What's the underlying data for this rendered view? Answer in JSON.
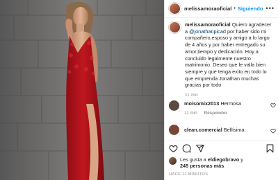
{
  "header": {
    "username": "melissamoraoficial",
    "separator": "•",
    "follow_label": "Siguiendo",
    "more_icon": "ellipsis-icon"
  },
  "caption": {
    "username": "melissamoraoficial",
    "text_before": "Quiero agradecer a ",
    "mention": "@jonathanpicad",
    "text_after": " por haber sido mi compañero,esposo y amigo a lo largo de 4 años y por haber entregado su amor,tiempo y dedicación. Hoy a concluido legalmente nuestro matrimonio. Deseo que le valla bien siempre y que tenga exito en todo lo que emprenda Jonathan muchas gracias por todo",
    "time": "11 min"
  },
  "comments": [
    {
      "username": "moisomix2013",
      "text": "Hermosa",
      "time": "11 min",
      "reply_label": "Responder",
      "avatar_color": "#5b4a42"
    },
    {
      "username": "clean.comercial",
      "text": "Bellísima",
      "avatar_color": "#7a4638"
    }
  ],
  "likes": {
    "prefix": "Les gusta a ",
    "liker": "eldiegobravo",
    "middle": " y",
    "count_text": "245 personas más"
  },
  "timestamp": "HACE 11 MINUTOS",
  "colors": {
    "accent": "#0095f6",
    "mention": "#00376b",
    "muted": "#8e8e8e",
    "dress": "#b3151c"
  }
}
